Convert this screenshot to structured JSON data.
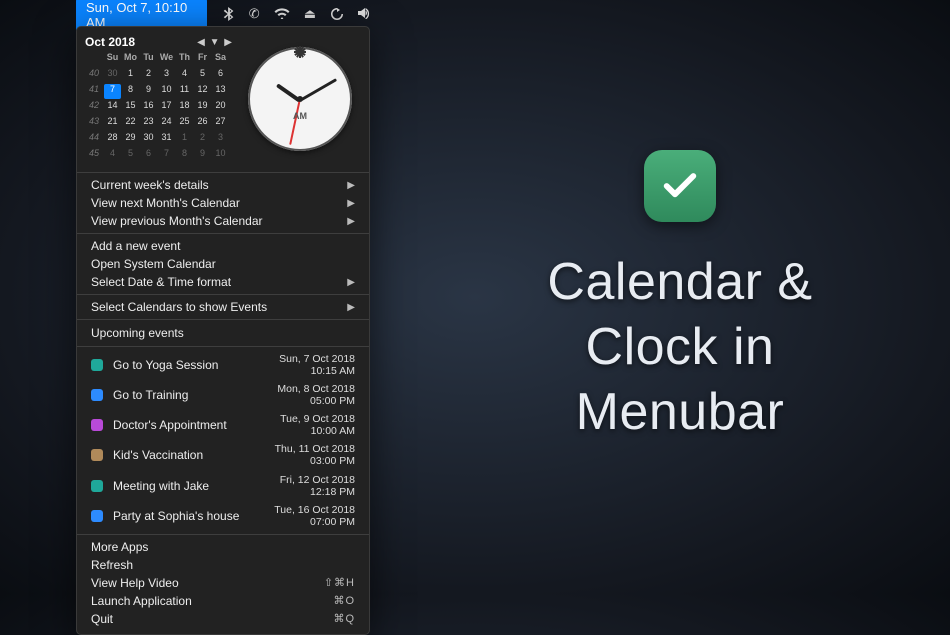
{
  "menubar": {
    "date_label": "Sun, Oct 7, 10:10 AM",
    "icons": [
      "bluetooth-icon",
      "phone-icon",
      "wifi-icon",
      "eject-icon",
      "timemachine-icon",
      "volume-icon"
    ]
  },
  "calendar": {
    "title": "Oct 2018",
    "day_headers": [
      "Su",
      "Mo",
      "Tu",
      "We",
      "Th",
      "Fr",
      "Sa"
    ],
    "week_numbers": [
      "40",
      "41",
      "42",
      "43",
      "44",
      "45"
    ],
    "cells": [
      {
        "n": "30",
        "dim": true
      },
      {
        "n": "1"
      },
      {
        "n": "2"
      },
      {
        "n": "3"
      },
      {
        "n": "4"
      },
      {
        "n": "5"
      },
      {
        "n": "6"
      },
      {
        "n": "7",
        "sel": true
      },
      {
        "n": "8"
      },
      {
        "n": "9"
      },
      {
        "n": "10"
      },
      {
        "n": "11"
      },
      {
        "n": "12"
      },
      {
        "n": "13"
      },
      {
        "n": "14"
      },
      {
        "n": "15"
      },
      {
        "n": "16"
      },
      {
        "n": "17"
      },
      {
        "n": "18"
      },
      {
        "n": "19"
      },
      {
        "n": "20"
      },
      {
        "n": "21"
      },
      {
        "n": "22"
      },
      {
        "n": "23"
      },
      {
        "n": "24"
      },
      {
        "n": "25"
      },
      {
        "n": "26"
      },
      {
        "n": "27"
      },
      {
        "n": "28"
      },
      {
        "n": "29"
      },
      {
        "n": "30"
      },
      {
        "n": "31"
      },
      {
        "n": "1",
        "dim": true
      },
      {
        "n": "2",
        "dim": true
      },
      {
        "n": "3",
        "dim": true
      },
      {
        "n": "4",
        "dim": true
      },
      {
        "n": "5",
        "dim": true
      },
      {
        "n": "6",
        "dim": true
      },
      {
        "n": "7",
        "dim": true
      },
      {
        "n": "8",
        "dim": true
      },
      {
        "n": "9",
        "dim": true
      },
      {
        "n": "10",
        "dim": true
      }
    ]
  },
  "clock": {
    "hour": 10,
    "minute": 10,
    "second": 32,
    "ampm": "AM"
  },
  "menu_group_1": [
    {
      "label": "Current week's details",
      "sub": true
    },
    {
      "label": "View next Month's Calendar",
      "sub": true
    },
    {
      "label": "View previous Month's Calendar",
      "sub": true
    }
  ],
  "menu_group_2": [
    {
      "label": "Add a new event"
    },
    {
      "label": "Open System Calendar"
    },
    {
      "label": "Select Date & Time format",
      "sub": true
    }
  ],
  "menu_group_3": [
    {
      "label": "Select Calendars to show Events",
      "sub": true
    }
  ],
  "upcoming_label": "Upcoming events",
  "events": [
    {
      "color": "#1fa89a",
      "title": "Go to Yoga Session",
      "date": "Sun, 7 Oct 2018",
      "time": "10:15 AM"
    },
    {
      "color": "#2d8bff",
      "title": "Go to Training",
      "date": "Mon, 8 Oct 2018",
      "time": "05:00 PM"
    },
    {
      "color": "#b94ad8",
      "title": "Doctor's Appointment",
      "date": "Tue, 9 Oct 2018",
      "time": "10:00 AM"
    },
    {
      "color": "#b08a5a",
      "title": "Kid's Vaccination",
      "date": "Thu, 11 Oct 2018",
      "time": "03:00 PM"
    },
    {
      "color": "#1fa89a",
      "title": "Meeting with Jake",
      "date": "Fri, 12 Oct 2018",
      "time": "12:18 PM"
    },
    {
      "color": "#2d8bff",
      "title": "Party at Sophia's house",
      "date": "Tue, 16 Oct 2018",
      "time": "07:00 PM"
    }
  ],
  "menu_group_4": [
    {
      "label": "More Apps"
    },
    {
      "label": "Refresh"
    },
    {
      "label": "View Help Video",
      "keys": "⇧⌘H"
    },
    {
      "label": "Launch Application",
      "keys": "⌘O"
    },
    {
      "label": "Quit",
      "keys": "⌘Q"
    }
  ],
  "promo": {
    "title_line1": "Calendar &",
    "title_line2": "Clock in",
    "title_line3": "Menubar"
  },
  "glyphs": {
    "bluetooth": "ᛒ",
    "phone": "✆",
    "wifi": "⌵",
    "eject": "⏏",
    "timemachine": "↺",
    "volume": "🔊"
  }
}
